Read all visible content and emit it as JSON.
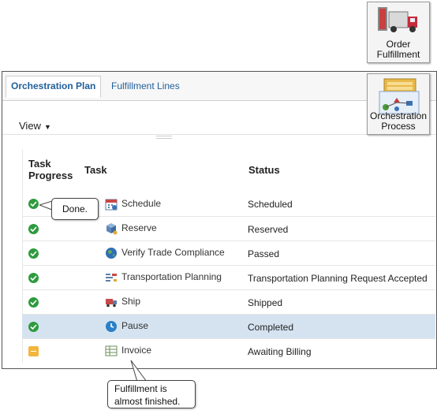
{
  "badges": {
    "order_fulfillment": "Order Fulfillment",
    "order_fulfillment_line1": "Order",
    "order_fulfillment_line2": "Fulfillment",
    "orchestration_process_line1": "Orchestration",
    "orchestration_process_line2": "Process"
  },
  "tabs": [
    {
      "label": "Orchestration Plan",
      "active": true
    },
    {
      "label": "Fulfillment Lines",
      "active": false
    }
  ],
  "toolbar": {
    "view_label": "View"
  },
  "table": {
    "headers": {
      "progress_line1": "Task",
      "progress_line2": "Progress",
      "task": "Task",
      "status": "Status"
    },
    "rows": [
      {
        "progress": "complete",
        "task": "Schedule",
        "icon": "calendar-icon",
        "status": "Scheduled",
        "selected": false
      },
      {
        "progress": "complete",
        "task": "Reserve",
        "icon": "reserve-icon",
        "status": "Reserved",
        "selected": false
      },
      {
        "progress": "complete",
        "task": "Verify Trade Compliance",
        "icon": "globe-icon",
        "status": "Passed",
        "selected": false
      },
      {
        "progress": "complete",
        "task": "Transportation Planning",
        "icon": "transport-icon",
        "status": "Transportation Planning Request Accepted",
        "selected": false
      },
      {
        "progress": "complete",
        "task": "Ship",
        "icon": "truck-icon",
        "status": "Shipped",
        "selected": false
      },
      {
        "progress": "complete",
        "task": "Pause",
        "icon": "clock-icon",
        "status": "Completed",
        "selected": true
      },
      {
        "progress": "pending",
        "task": "Invoice",
        "icon": "invoice-icon",
        "status": "Awaiting Billing",
        "selected": false
      }
    ]
  },
  "callouts": {
    "done": "Done.",
    "almost_line1": "Fulfillment is",
    "almost_line2": "almost finished."
  },
  "colors": {
    "complete": "#2e9b3e",
    "pending": "#f2b63d",
    "selected_row": "#d5e3f1",
    "tab_text": "#1f5f99"
  }
}
